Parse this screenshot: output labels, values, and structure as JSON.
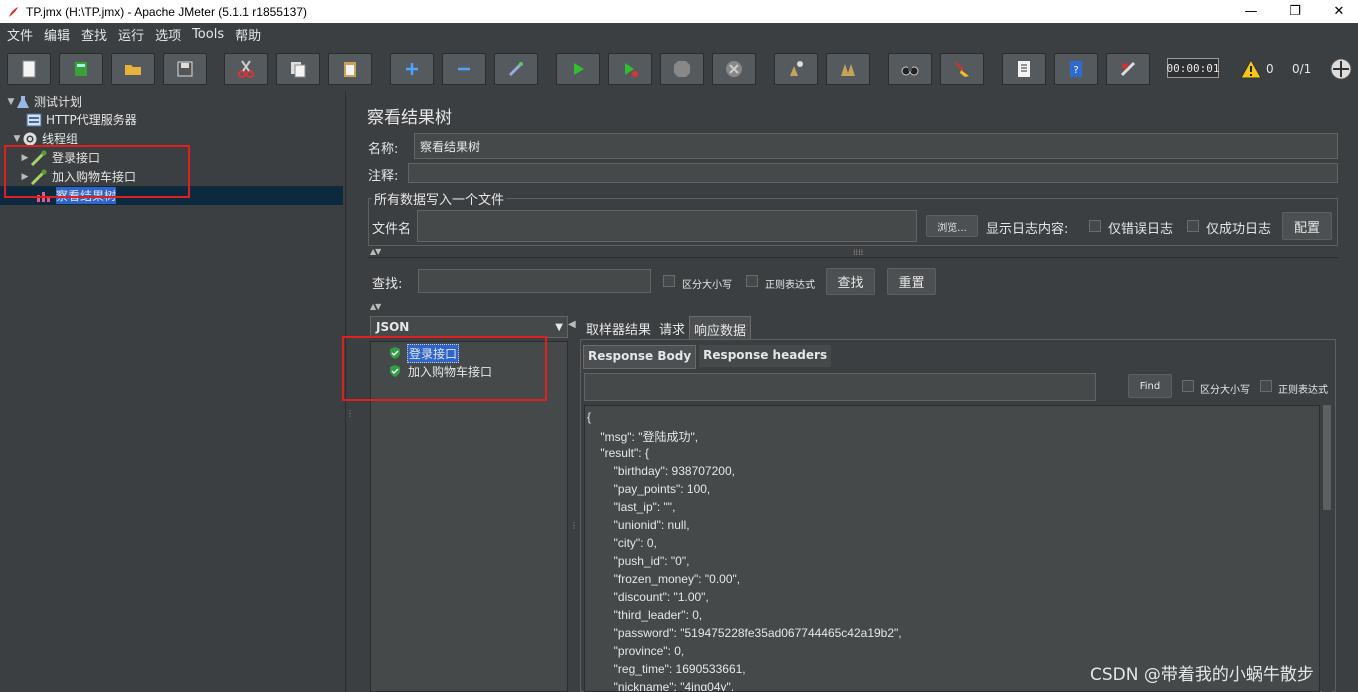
{
  "window": {
    "title": "TP.jmx (H:\\TP.jmx) - Apache JMeter (5.1.1 r1855137)",
    "minimize": "—",
    "restore": "❐",
    "close": "✕"
  },
  "menu": [
    "文件",
    "编辑",
    "查找",
    "运行",
    "选项",
    "Tools",
    "帮助"
  ],
  "toolbar": {
    "icons": [
      "new-icon",
      "templates-icon",
      "open-icon",
      "save-icon",
      "cut-icon",
      "copy-icon",
      "paste-icon",
      "expand-icon",
      "collapse-icon",
      "toggle-icon",
      "start-icon",
      "start-no-pause-icon",
      "stop-icon",
      "shutdown-icon",
      "clear-icon",
      "clear-all-icon",
      "search-icon",
      "reset-search-icon",
      "function-helper-icon",
      "help-icon",
      "remote-icon"
    ],
    "timer": "00:00:01",
    "warnings": "0",
    "threads": "0/1"
  },
  "tree": {
    "test_plan": "测试计划",
    "http_proxy": "HTTP代理服务器",
    "thread_group": "线程组",
    "login": "登录接口",
    "add_cart": "加入购物车接口",
    "results_tree": "察看结果树"
  },
  "panel": {
    "title": "察看结果树",
    "name_label": "名称:",
    "name_value": "察看结果树",
    "comment_label": "注释:",
    "comment_value": "",
    "write_group": "所有数据写入一个文件",
    "filename_label": "文件名",
    "filename_value": "",
    "browse_label": "浏览...",
    "log_label": "显示日志内容:",
    "errors_only": "仅错误日志",
    "success_only": "仅成功日志",
    "configure": "配置",
    "search_label": "查找:",
    "search_value": "",
    "case_sensitive": "区分大小写",
    "regex": "正则表达式",
    "search_btn": "查找",
    "reset_btn": "重置"
  },
  "results": {
    "renderer": "JSON",
    "items": [
      "登录接口",
      "加入购物车接口"
    ]
  },
  "tabs": [
    "取样器结果",
    "请求",
    "响应数据"
  ],
  "subtabs": [
    "Response Body",
    "Response headers"
  ],
  "find": {
    "value": "",
    "button": "Find",
    "case_sensitive": "区分大小写",
    "regex": "正则表达式"
  },
  "response_lines": [
    "{",
    "    \"msg\": \"登陆成功\",",
    "    \"result\": {",
    "        \"birthday\": 938707200,",
    "        \"pay_points\": 100,",
    "        \"last_ip\": \"\",",
    "        \"unionid\": null,",
    "        \"city\": 0,",
    "        \"push_id\": \"0\",",
    "        \"frozen_money\": \"0.00\",",
    "        \"discount\": \"1.00\",",
    "        \"third_leader\": 0,",
    "        \"password\": \"519475228fe35ad067744465c42a19b2\",",
    "        \"province\": 0,",
    "        \"reg_time\": 1690533661,",
    "        \"nickname\": \"4ing04y\","
  ],
  "watermark": "CSDN @带着我的小蜗牛散步"
}
